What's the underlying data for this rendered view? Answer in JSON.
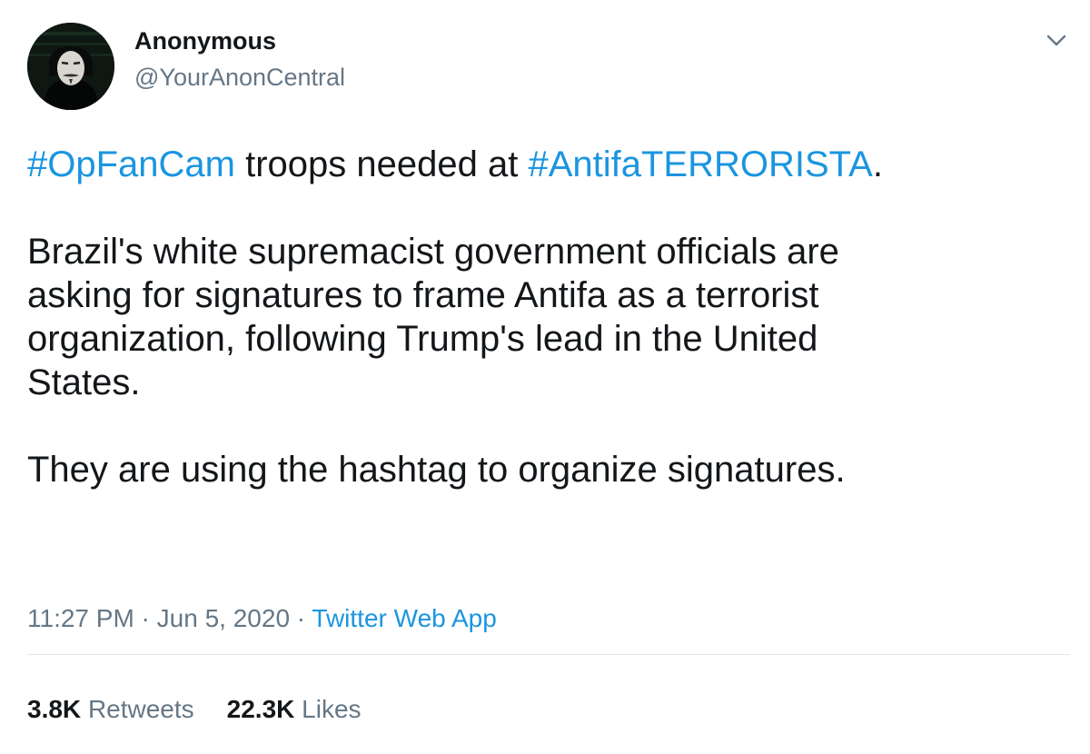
{
  "author": {
    "display_name": "Anonymous",
    "handle": "@YourAnonCentral",
    "avatar_icon": "anonymous-mask-avatar"
  },
  "menu": {
    "icon": "chevron-down-icon"
  },
  "tweet": {
    "line1": {
      "hashtag1": "#OpFanCam",
      "middle": " troops needed at ",
      "hashtag2": "#AntifaTERRORISTA",
      "end": "."
    },
    "para2_lines": [
      "Brazil's white supremacist government officials are",
      "asking for signatures to frame Antifa as a terrorist",
      "organization, following Trump's lead in the United",
      "States."
    ],
    "para3": "They are using the hashtag to organize signatures."
  },
  "meta": {
    "time": "11:27 PM",
    "separator": " · ",
    "date": "Jun 5, 2020",
    "source": "Twitter Web App"
  },
  "stats": {
    "retweets_count": "3.8K",
    "retweets_label": "Retweets",
    "likes_count": "22.3K",
    "likes_label": "Likes"
  },
  "colors": {
    "link": "#1b95e0",
    "secondary_text": "#657786",
    "primary_text": "#14171a",
    "divider": "#e1e8ed"
  }
}
